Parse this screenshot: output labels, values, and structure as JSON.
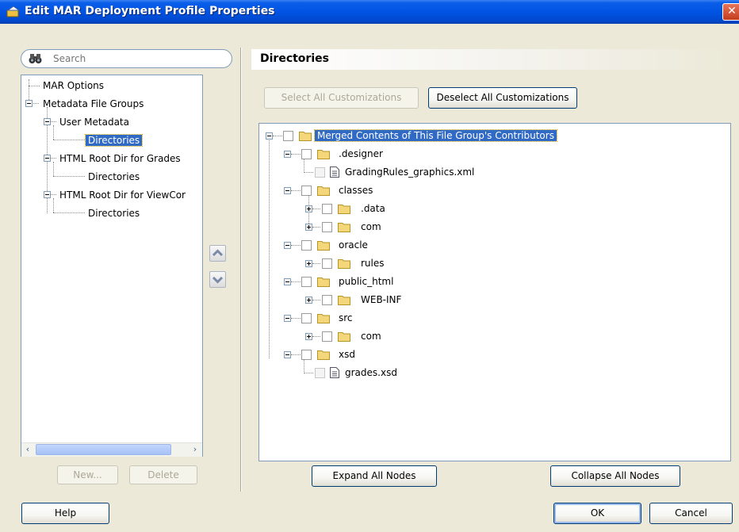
{
  "window": {
    "title": "Edit MAR Deployment Profile Properties"
  },
  "search": {
    "placeholder": "Search"
  },
  "nav_tree": [
    {
      "label": "MAR Options"
    },
    {
      "label": "Metadata File Groups"
    },
    {
      "label": "User Metadata"
    },
    {
      "label": "Directories",
      "selected": true
    },
    {
      "label": "HTML Root Dir for Grades"
    },
    {
      "label": "Directories"
    },
    {
      "label": "HTML Root Dir for ViewCor"
    },
    {
      "label": "Directories"
    }
  ],
  "left_buttons": {
    "new": "New...",
    "delete": "Delete"
  },
  "section": {
    "title": "Directories"
  },
  "buttons": {
    "select_all": "Select All Customizations",
    "deselect_all": "Deselect All Customizations",
    "expand_all": "Expand All Nodes",
    "collapse_all": "Collapse All Nodes",
    "help": "Help",
    "ok": "OK",
    "cancel": "Cancel"
  },
  "contents_tree": [
    {
      "label": "Merged Contents of This File Group's Contributors",
      "icon": "folder-icon",
      "selected": true
    },
    {
      "label": ".designer",
      "icon": "folder-icon"
    },
    {
      "label": "GradingRules_graphics.xml",
      "icon": "file-icon"
    },
    {
      "label": "classes",
      "icon": "folder-icon"
    },
    {
      "label": ".data",
      "icon": "folder-icon"
    },
    {
      "label": "com",
      "icon": "folder-icon"
    },
    {
      "label": "oracle",
      "icon": "folder-icon"
    },
    {
      "label": "rules",
      "icon": "folder-icon"
    },
    {
      "label": "public_html",
      "icon": "folder-icon"
    },
    {
      "label": "WEB-INF",
      "icon": "folder-icon"
    },
    {
      "label": "src",
      "icon": "folder-icon"
    },
    {
      "label": "com",
      "icon": "folder-icon"
    },
    {
      "label": "xsd",
      "icon": "folder-icon"
    },
    {
      "label": "grades.xsd",
      "icon": "file-icon"
    }
  ],
  "colors": {
    "titlebar": "#0054e3",
    "selection": "#316ac5",
    "dialog_bg": "#ece9d8"
  }
}
